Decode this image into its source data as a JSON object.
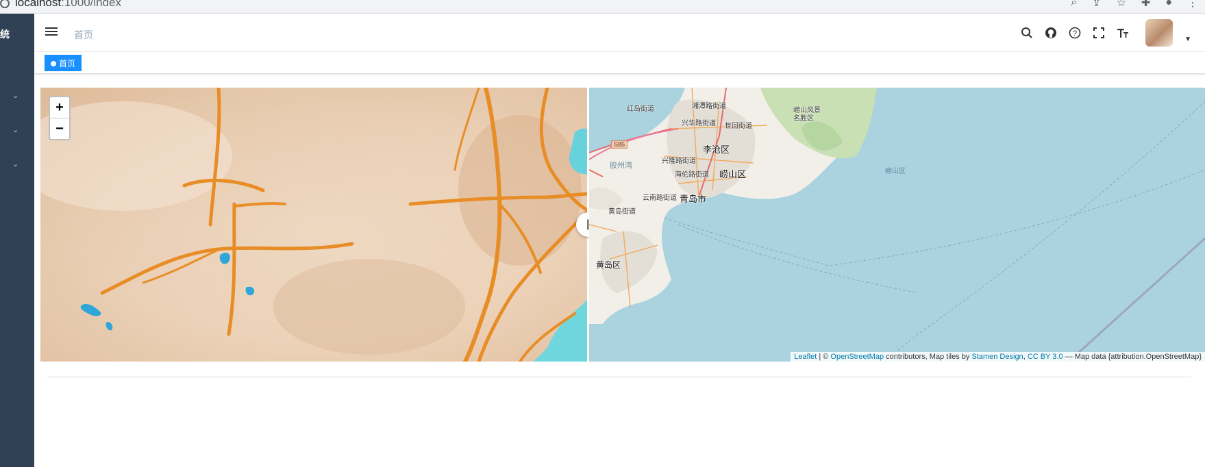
{
  "browser": {
    "url_host": "localhost",
    "url_path": ":1000/index"
  },
  "sidebar": {
    "title_fragment": "统",
    "chevrons": [
      "⌄",
      "⌄",
      "⌄"
    ]
  },
  "navbar": {
    "breadcrumb": "首页",
    "icons": [
      "search-icon",
      "github-icon",
      "question-icon",
      "fullscreen-icon",
      "font-size-icon"
    ]
  },
  "tags": {
    "active": "首页"
  },
  "map": {
    "zoom_in": "+",
    "zoom_out": "−",
    "divider_handle": "|||",
    "labels": {
      "hongdao": "红岛街道",
      "xiangtan": "湘潭路街道",
      "xinghua": "兴华路街道",
      "shihui": "世回街道",
      "laoshan_scenic": "崂山风景\n名胜区",
      "licang": "李沧区",
      "jiaozhou_bay": "胶州湾",
      "xinglong": "兴隆路街道",
      "hailun": "海伦路街道",
      "laoshan": "崂山区",
      "laoshan_sea": "崂山区",
      "yunnan": "云南路街道",
      "qingdao": "青岛市",
      "huangdao_street": "黄岛街道",
      "huangdao": "黄岛区",
      "s85": "S85"
    },
    "attribution": {
      "leaflet": "Leaflet",
      "sep": " | © ",
      "osm": "OpenStreetMap",
      "contrib": " contributors, Map tiles by ",
      "stamen": "Stamen Design",
      "comma": ", ",
      "ccby": "CC BY 3.0",
      "tail": " — Map data {attribution.OpenStreetMap}"
    }
  }
}
